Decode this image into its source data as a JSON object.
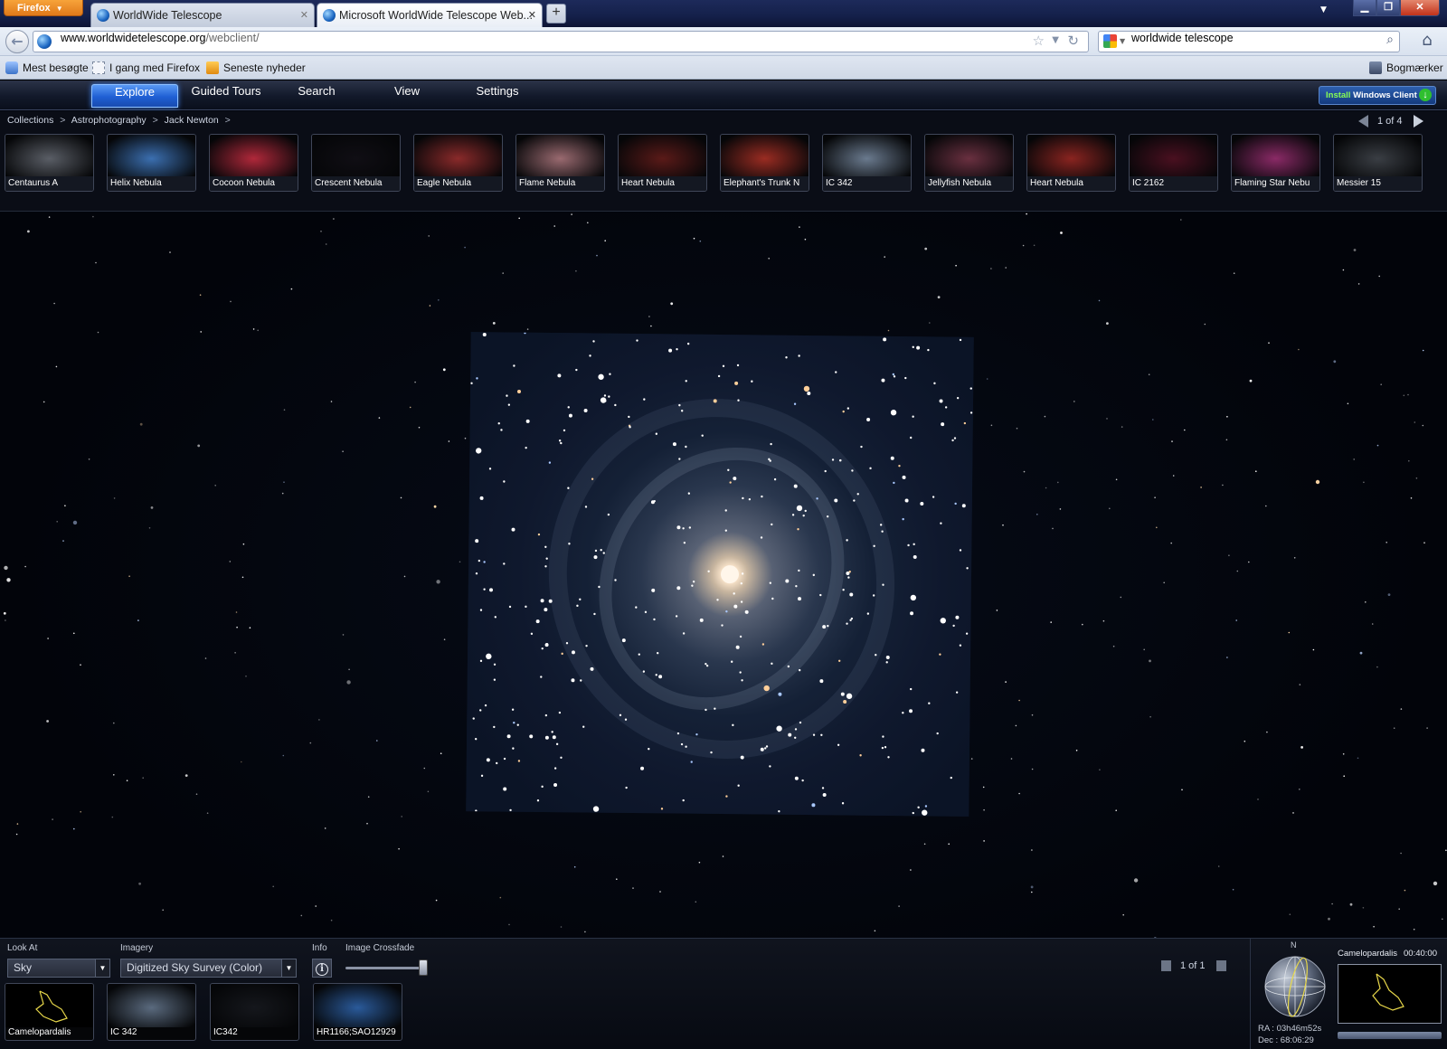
{
  "browser": {
    "menu_button": "Firefox",
    "tabs": [
      {
        "title": "WorldWide Telescope",
        "active": false
      },
      {
        "title": "Microsoft WorldWide Telescope Web...",
        "active": true
      }
    ],
    "new_tab": "+",
    "url_prefix": "www.worldwidetelescope.org",
    "url_path": "/webclient/",
    "search_query": "worldwide telescope",
    "bookmarks": [
      "Mest besøgte",
      "I gang med Firefox",
      "Seneste nyheder"
    ],
    "bookmarks_menu": "Bogmærker"
  },
  "wwt": {
    "menu": [
      {
        "label": "Explore",
        "active": true
      },
      {
        "label": "Guided Tours",
        "active": false
      },
      {
        "label": "Search",
        "active": false
      },
      {
        "label": "View",
        "active": false
      },
      {
        "label": "Settings",
        "active": false
      }
    ],
    "install": {
      "part1": "Install",
      "part2": "Windows Client"
    },
    "breadcrumb": [
      "Collections",
      "Astrophotography",
      "Jack Newton"
    ],
    "breadcrumb_sep": ">",
    "pager": "1 of 4",
    "collection_items": [
      {
        "label": "Centaurus A",
        "color": "#5a5e66"
      },
      {
        "label": "Helix Nebula",
        "color": "#3b6fb0"
      },
      {
        "label": "Cocoon Nebula",
        "color": "#b0283a"
      },
      {
        "label": "Crescent Nebula",
        "color": "#100e14"
      },
      {
        "label": "Eagle Nebula",
        "color": "#8a2a2a"
      },
      {
        "label": "Flame Nebula",
        "color": "#9a6a70"
      },
      {
        "label": "Heart Nebula",
        "color": "#5a1a18"
      },
      {
        "label": "Elephant's Trunk N",
        "color": "#9a2c22"
      },
      {
        "label": "IC 342",
        "color": "#6a7a8e"
      },
      {
        "label": "Jellyfish Nebula",
        "color": "#6a3040"
      },
      {
        "label": "Heart Nebula",
        "color": "#8a2420"
      },
      {
        "label": "IC 2162",
        "color": "#4a1020"
      },
      {
        "label": "Flaming Star Nebu",
        "color": "#8a2a66"
      },
      {
        "label": "Messier 15",
        "color": "#3a3e44"
      }
    ],
    "bottom": {
      "look_at_label": "Look At",
      "look_at_value": "Sky",
      "imagery_label": "Imagery",
      "imagery_value": "Digitized Sky Survey (Color)",
      "info_label": "Info",
      "crossfade_label": "Image Crossfade",
      "crossfade": 0.95,
      "context_items": [
        {
          "label": "Camelopardalis",
          "color": "#000000"
        },
        {
          "label": "IC 342",
          "color": "#5a6a7e"
        },
        {
          "label": "IC342",
          "color": "#15171c"
        },
        {
          "label": "HR1166;SAO12929",
          "color": "#2a5a9a"
        }
      ],
      "pager": "1 of 1",
      "north": "N",
      "ra": "RA : 03h46m52s",
      "dec": "Dec : 68:06:29",
      "constellation": "Camelopardalis",
      "time": "00:40:00"
    }
  }
}
